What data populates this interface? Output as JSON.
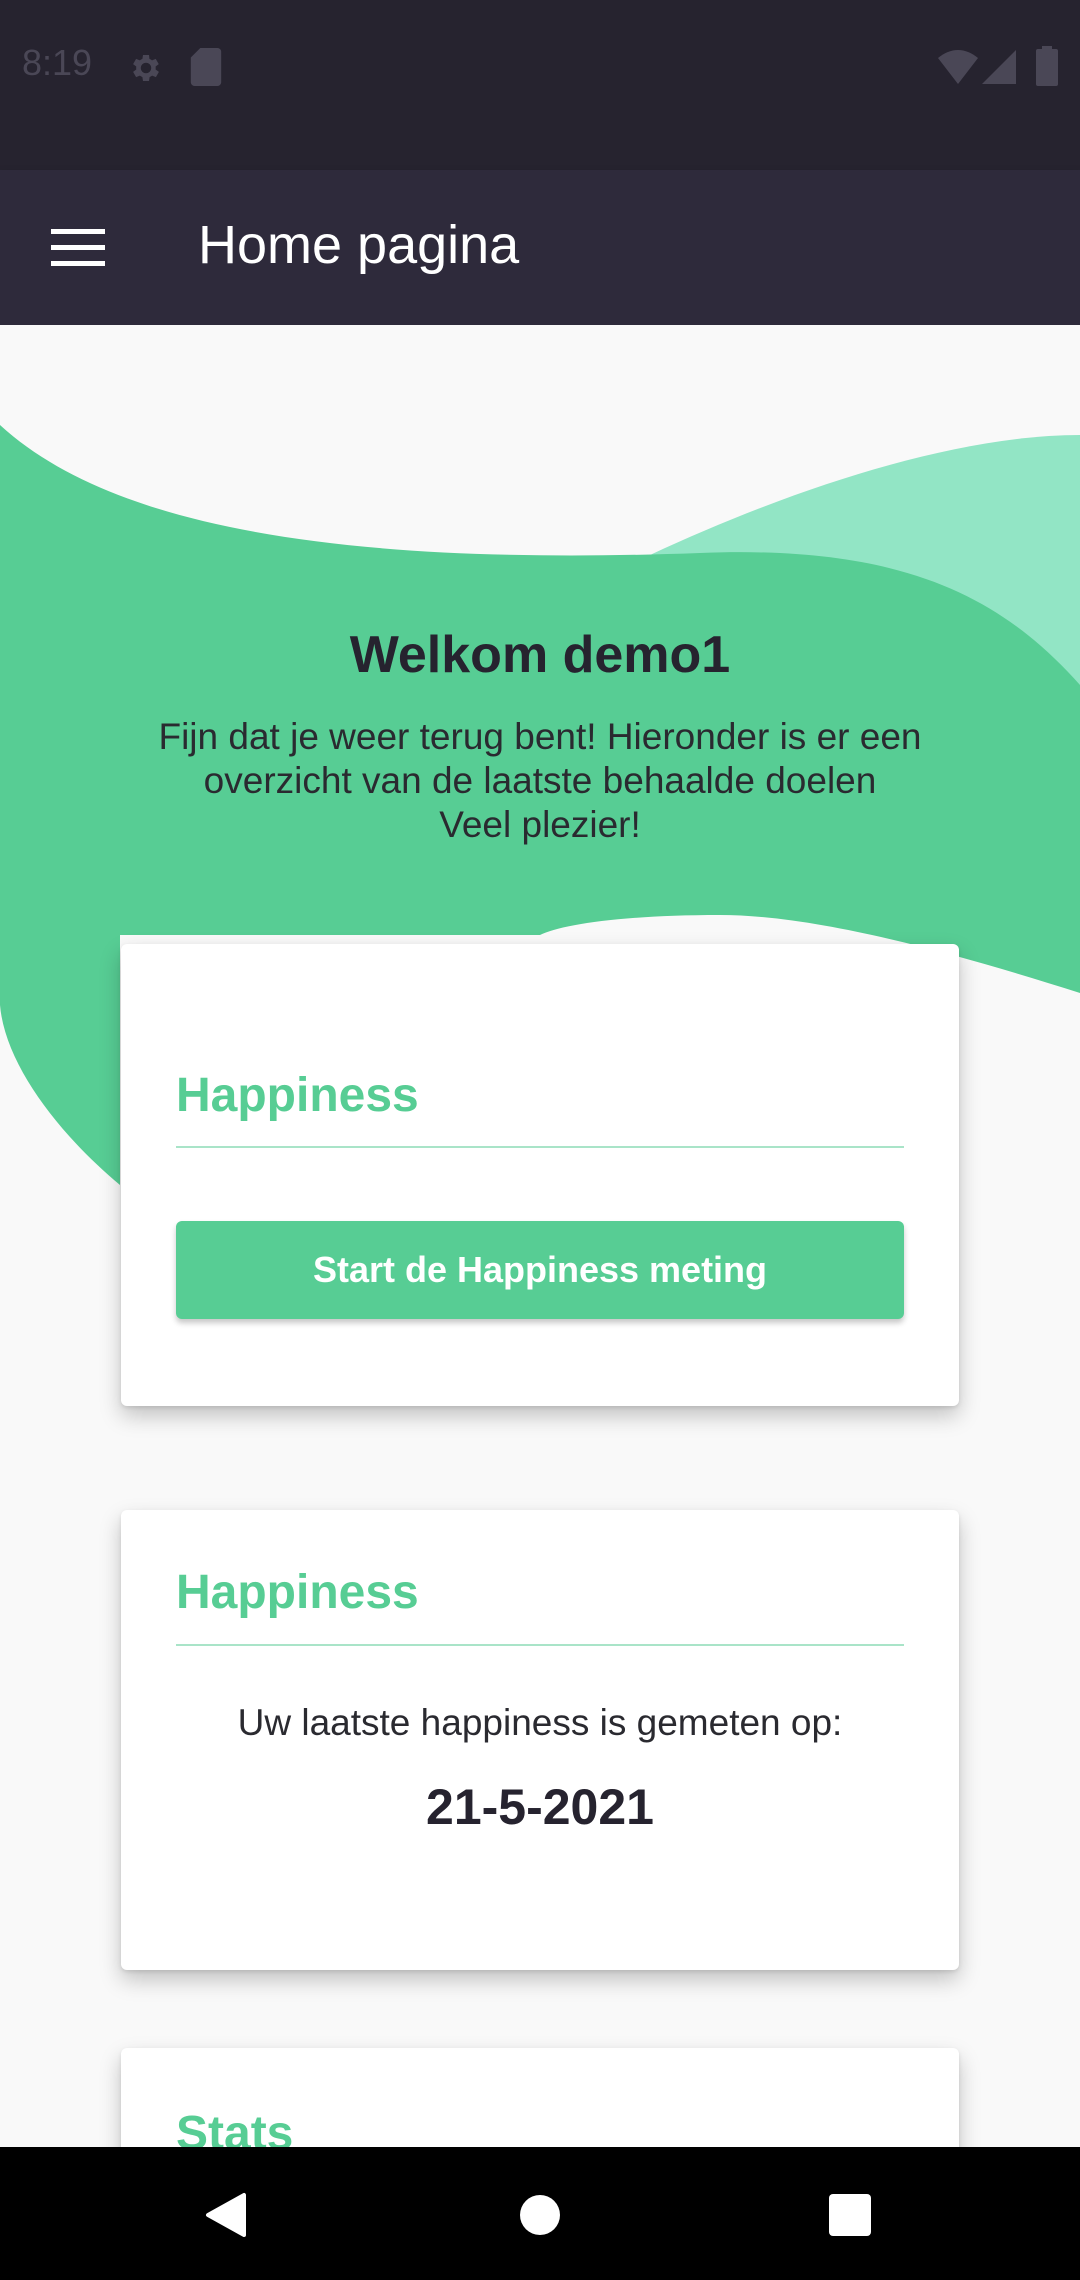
{
  "status_bar": {
    "time": "8:19",
    "icons": [
      "settings-icon",
      "sd-card-icon",
      "wifi-icon",
      "signal-icon",
      "battery-icon"
    ]
  },
  "app_bar": {
    "menu_icon": "menu-icon",
    "title": "Home pagina"
  },
  "welcome": {
    "title": "Welkom demo1",
    "lines": [
      "Fijn dat je weer terug bent! Hieronder is er een",
      "overzicht van de laatste behaalde doelen",
      "Veel plezier!"
    ]
  },
  "cards": {
    "happiness_start": {
      "title": "Happiness",
      "button_label": "Start de Happiness meting"
    },
    "happiness_last": {
      "title": "Happiness",
      "text": "Uw laatste happiness is gemeten op:",
      "date": "21-5-2021"
    },
    "stats": {
      "title": "Stats"
    }
  },
  "colors": {
    "accent": "#57cd94",
    "accent_light": "#92e5c5",
    "dark": "#26232f",
    "app_bar": "#2e2a3b"
  },
  "nav_bar": {
    "icons": [
      "back-icon",
      "home-icon",
      "recents-icon"
    ]
  }
}
